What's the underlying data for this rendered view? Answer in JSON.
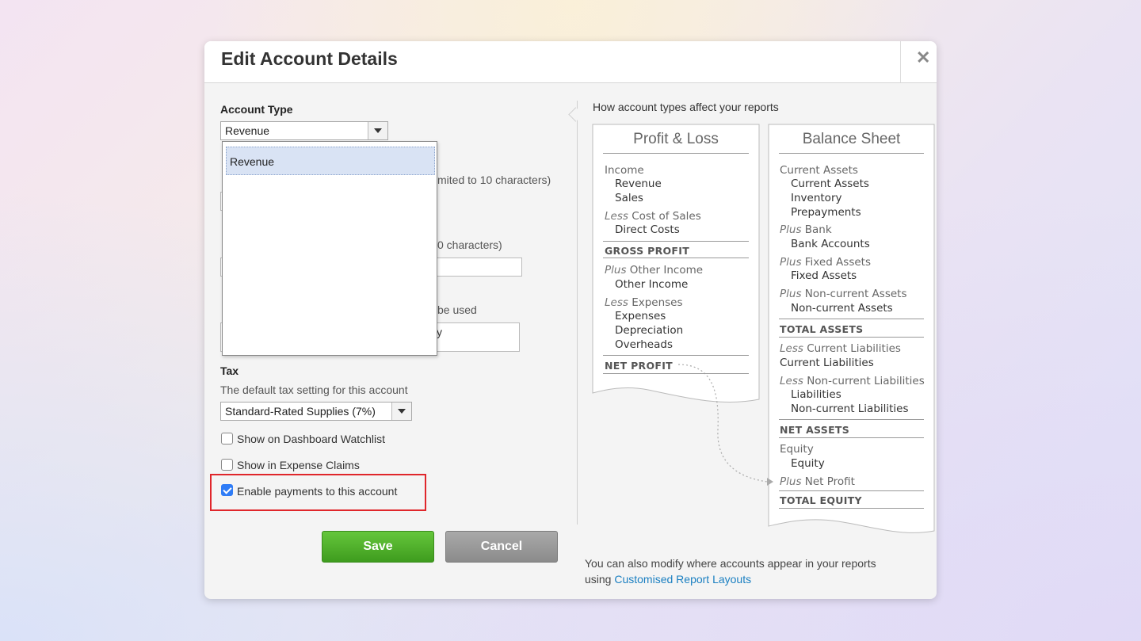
{
  "dialog": {
    "title": "Edit Account Details",
    "close_glyph": "✕"
  },
  "form": {
    "account_type": {
      "label": "Account Type",
      "selected": "Revenue",
      "dropdown_options": [
        "Revenue"
      ]
    },
    "hidden_texts": {
      "code_hint_fragment": "mited to 10 characters)",
      "name_hint_fragment": "0 characters)",
      "description_hint_fragment": "be used",
      "description_value_fragment": "y"
    },
    "tax": {
      "label": "Tax",
      "helper": "The default tax setting for this account",
      "selected": "Standard-Rated Supplies (7%)"
    },
    "checkboxes": [
      {
        "label": "Show on Dashboard Watchlist",
        "checked": false
      },
      {
        "label": "Show in Expense Claims",
        "checked": false
      },
      {
        "label": "Enable payments to this account",
        "checked": true
      }
    ],
    "buttons": {
      "save": "Save",
      "cancel": "Cancel"
    }
  },
  "help": {
    "heading": "How account types affect your reports",
    "profit_loss": {
      "title": "Profit & Loss",
      "income": "Income",
      "revenue": "Revenue",
      "sales": "Sales",
      "less": "Less",
      "cost_of_sales": " Cost of Sales",
      "direct_costs": "Direct Costs",
      "gross_profit": "GROSS PROFIT",
      "plus": "Plus",
      "other_income_h": " Other Income",
      "other_income": "Other Income",
      "expenses_h": " Expenses",
      "expenses": "Expenses",
      "depreciation": "Depreciation",
      "overheads": "Overheads",
      "net_profit": "NET PROFIT"
    },
    "balance_sheet": {
      "title": "Balance Sheet",
      "current_assets_h": "Current Assets",
      "current_assets": "Current Assets",
      "inventory": "Inventory",
      "prepayments": "Prepayments",
      "plus": "Plus",
      "less": "Less",
      "bank_h": " Bank",
      "bank_accounts": "Bank Accounts",
      "fixed_assets_h": " Fixed Assets",
      "fixed_assets": "Fixed Assets",
      "noncurrent_assets_h": " Non-current Assets",
      "noncurrent_assets": "Non-current Assets",
      "total_assets": "TOTAL ASSETS",
      "current_liabilities_h": " Current Liabilities",
      "current_liabilities": "Current Liabilities",
      "noncurrent_liabilities_h": " Non-current Liabilities",
      "liabilities": "Liabilities",
      "noncurrent_liabilities": "Non-current Liabilities",
      "net_assets": "NET ASSETS",
      "equity_h": "Equity",
      "equity": "Equity",
      "net_profit": " Net Profit",
      "total_equity": "TOTAL EQUITY"
    },
    "footer": {
      "line1": "You can also modify where accounts appear in your reports",
      "line2_prefix": "using ",
      "link": "Customised Report Layouts"
    }
  }
}
